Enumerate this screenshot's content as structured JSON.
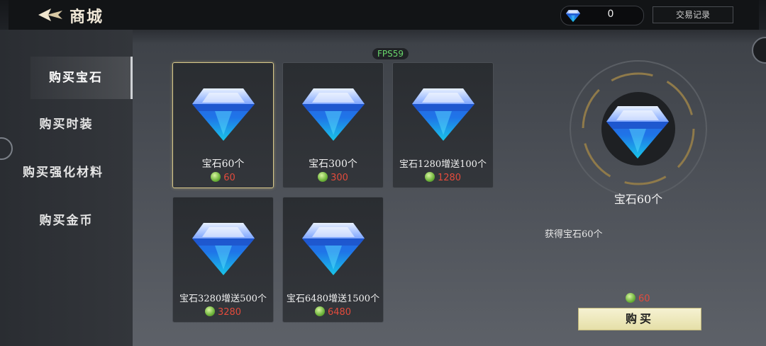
{
  "header": {
    "title": "商城",
    "gem_count": "0",
    "trade_record_label": "交易记录"
  },
  "sidebar": {
    "items": [
      {
        "label": "购买宝石",
        "active": true
      },
      {
        "label": "购买时装",
        "active": false
      },
      {
        "label": "购买强化材料",
        "active": false
      },
      {
        "label": "购买金币",
        "active": false
      }
    ]
  },
  "fps": "FPS59",
  "products": [
    {
      "name": "宝石60个",
      "price": "60",
      "selected": true
    },
    {
      "name": "宝石300个",
      "price": "300",
      "selected": false
    },
    {
      "name": "宝石1280增送100个",
      "price": "1280",
      "selected": false
    },
    {
      "name": "宝石3280增送500个",
      "price": "3280",
      "selected": false
    },
    {
      "name": "宝石6480增送1500个",
      "price": "6480",
      "selected": false
    }
  ],
  "detail": {
    "name": "宝石60个",
    "description": "获得宝石60个",
    "price": "60",
    "buy_label": "购买"
  },
  "colors": {
    "accent_gold": "#d8c98a",
    "price_red": "#e24b3c",
    "buy_button": "#f0ebc4"
  }
}
